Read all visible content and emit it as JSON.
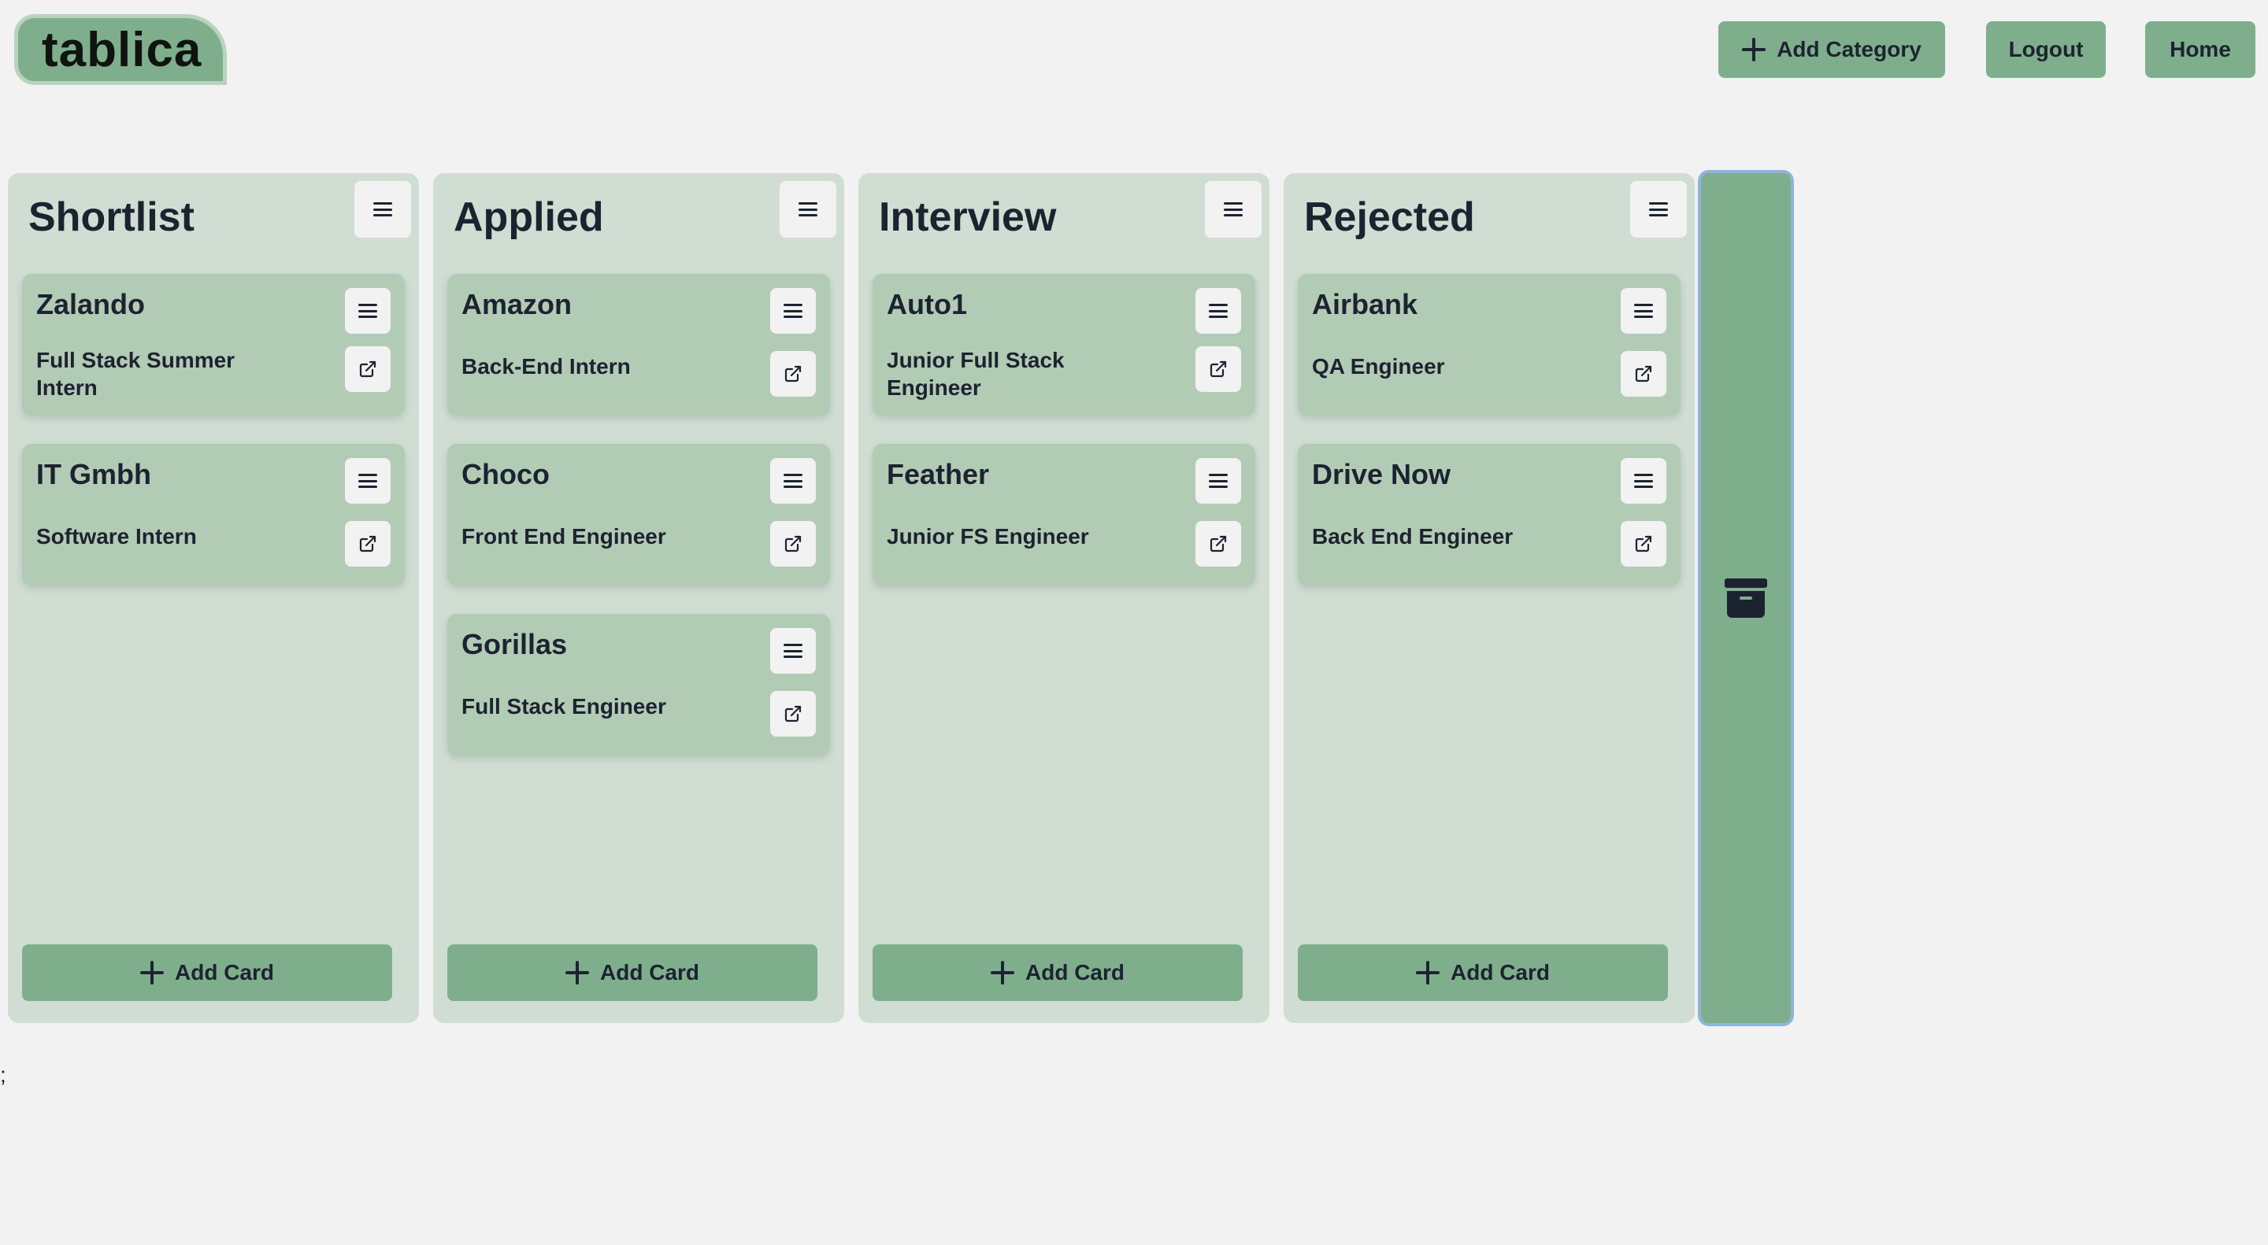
{
  "app": {
    "logo": "tablica"
  },
  "nav": {
    "add_category": "Add Category",
    "logout": "Logout",
    "home": "Home"
  },
  "columns": [
    {
      "title": "Shortlist",
      "cards": [
        {
          "company": "Zalando",
          "role": "Full Stack Summer Intern"
        },
        {
          "company": "IT Gmbh",
          "role": "Software Intern"
        }
      ]
    },
    {
      "title": "Applied",
      "cards": [
        {
          "company": "Amazon",
          "role": "Back-End Intern"
        },
        {
          "company": "Choco",
          "role": "Front End Engineer"
        },
        {
          "company": "Gorillas",
          "role": "Full Stack Engineer"
        }
      ]
    },
    {
      "title": "Interview",
      "cards": [
        {
          "company": "Auto1",
          "role": "Junior Full Stack Engineer"
        },
        {
          "company": "Feather",
          "role": "Junior FS Engineer"
        }
      ]
    },
    {
      "title": "Rejected",
      "cards": [
        {
          "company": "Airbank",
          "role": "QA Engineer"
        },
        {
          "company": "Drive Now",
          "role": "Back End Engineer"
        }
      ]
    }
  ],
  "add_card_label": "Add Card",
  "stray_text": ";",
  "icons": {
    "column_menu": "hamburger-icon",
    "card_menu": "hamburger-icon",
    "card_link": "external-link-icon",
    "add": "plus-icon",
    "archive": "archive-icon"
  },
  "colors": {
    "background": "#f2f2f2",
    "accent": "#7fae8c",
    "column": "#d0ddd3",
    "card": "#b2cbb5",
    "text": "#1c2330",
    "archive_border": "#8fb4d8"
  }
}
